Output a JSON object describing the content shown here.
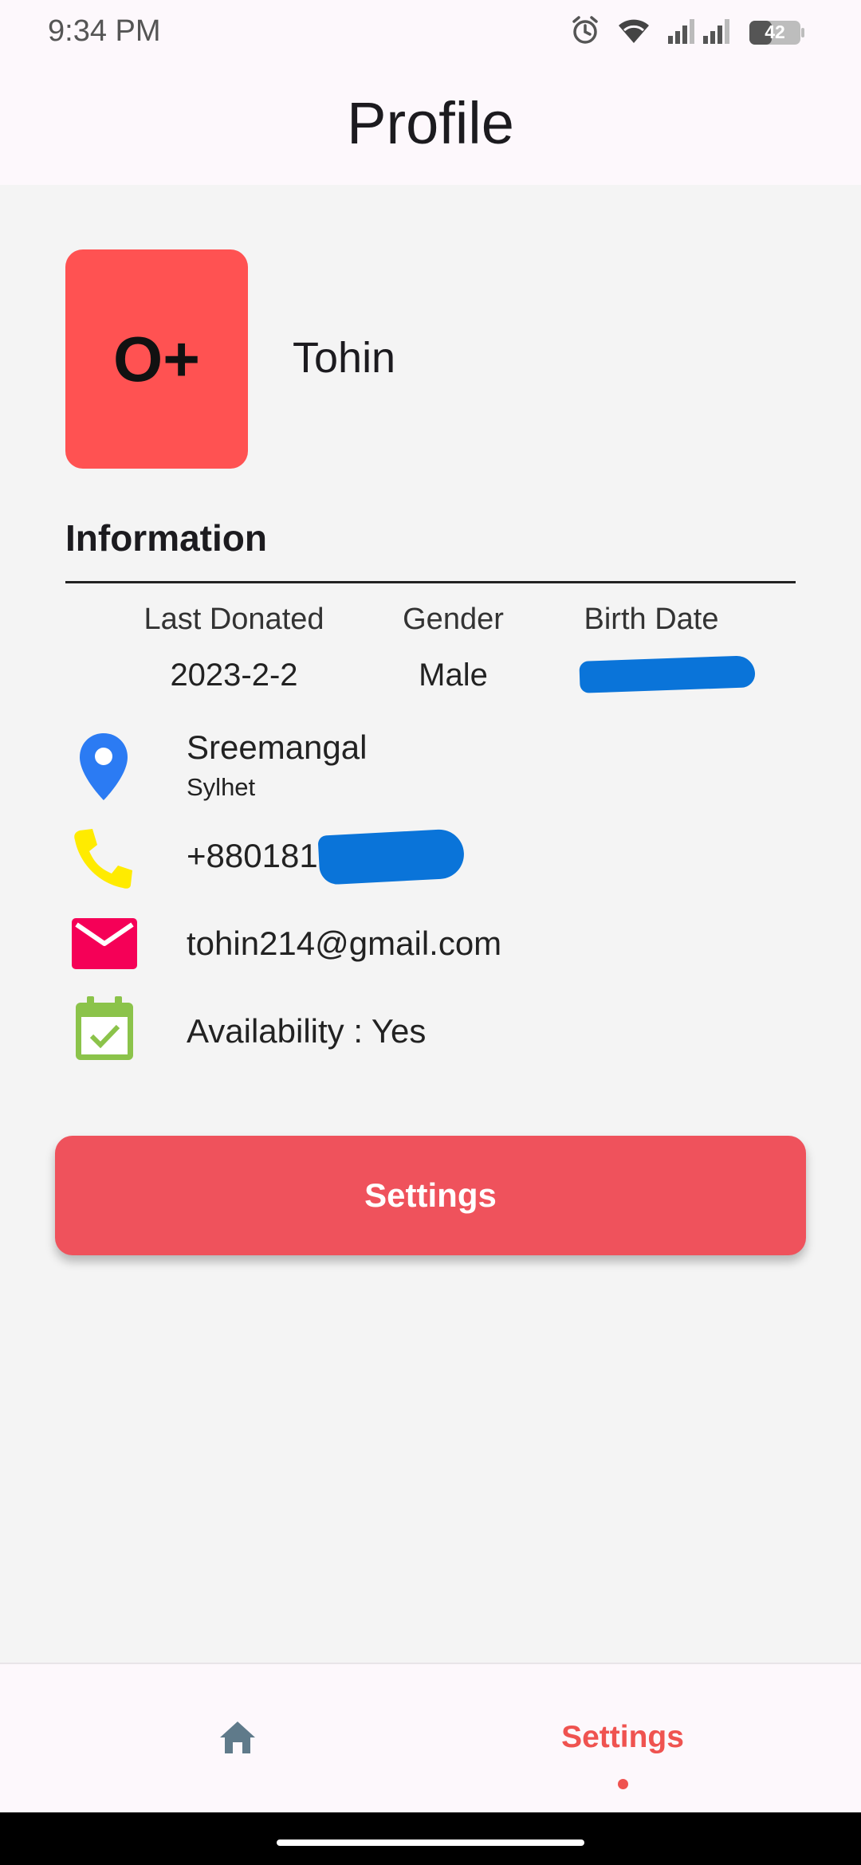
{
  "status": {
    "time": "9:34 PM",
    "battery": "42"
  },
  "header": {
    "title": "Profile"
  },
  "profile": {
    "blood_group": "O+",
    "name": "Tohin"
  },
  "info": {
    "title": "Information",
    "last_donated_label": "Last Donated",
    "last_donated_value": "2023-2-2",
    "gender_label": "Gender",
    "gender_value": "Male",
    "birth_date_label": "Birth Date",
    "location_city": "Sreemangal",
    "location_region": "Sylhet",
    "phone_prefix": "+880181",
    "email": "tohin214@gmail.com",
    "availability": "Availability : Yes"
  },
  "actions": {
    "settings_button": "Settings"
  },
  "nav": {
    "settings_label": "Settings"
  },
  "colors": {
    "blood_box": "#ff5252",
    "button": "#ef525c",
    "accent": "#ef5350",
    "location_icon": "#2b7bf3",
    "phone_icon": "#ffeb00",
    "mail_icon": "#f50057",
    "calendar_icon": "#8bc34a",
    "home_icon": "#5f7a8a"
  },
  "icons": [
    "alarm-icon",
    "wifi-icon",
    "signal-icon",
    "battery-icon",
    "location-pin-icon",
    "phone-icon",
    "mail-icon",
    "calendar-check-icon",
    "home-icon"
  ]
}
